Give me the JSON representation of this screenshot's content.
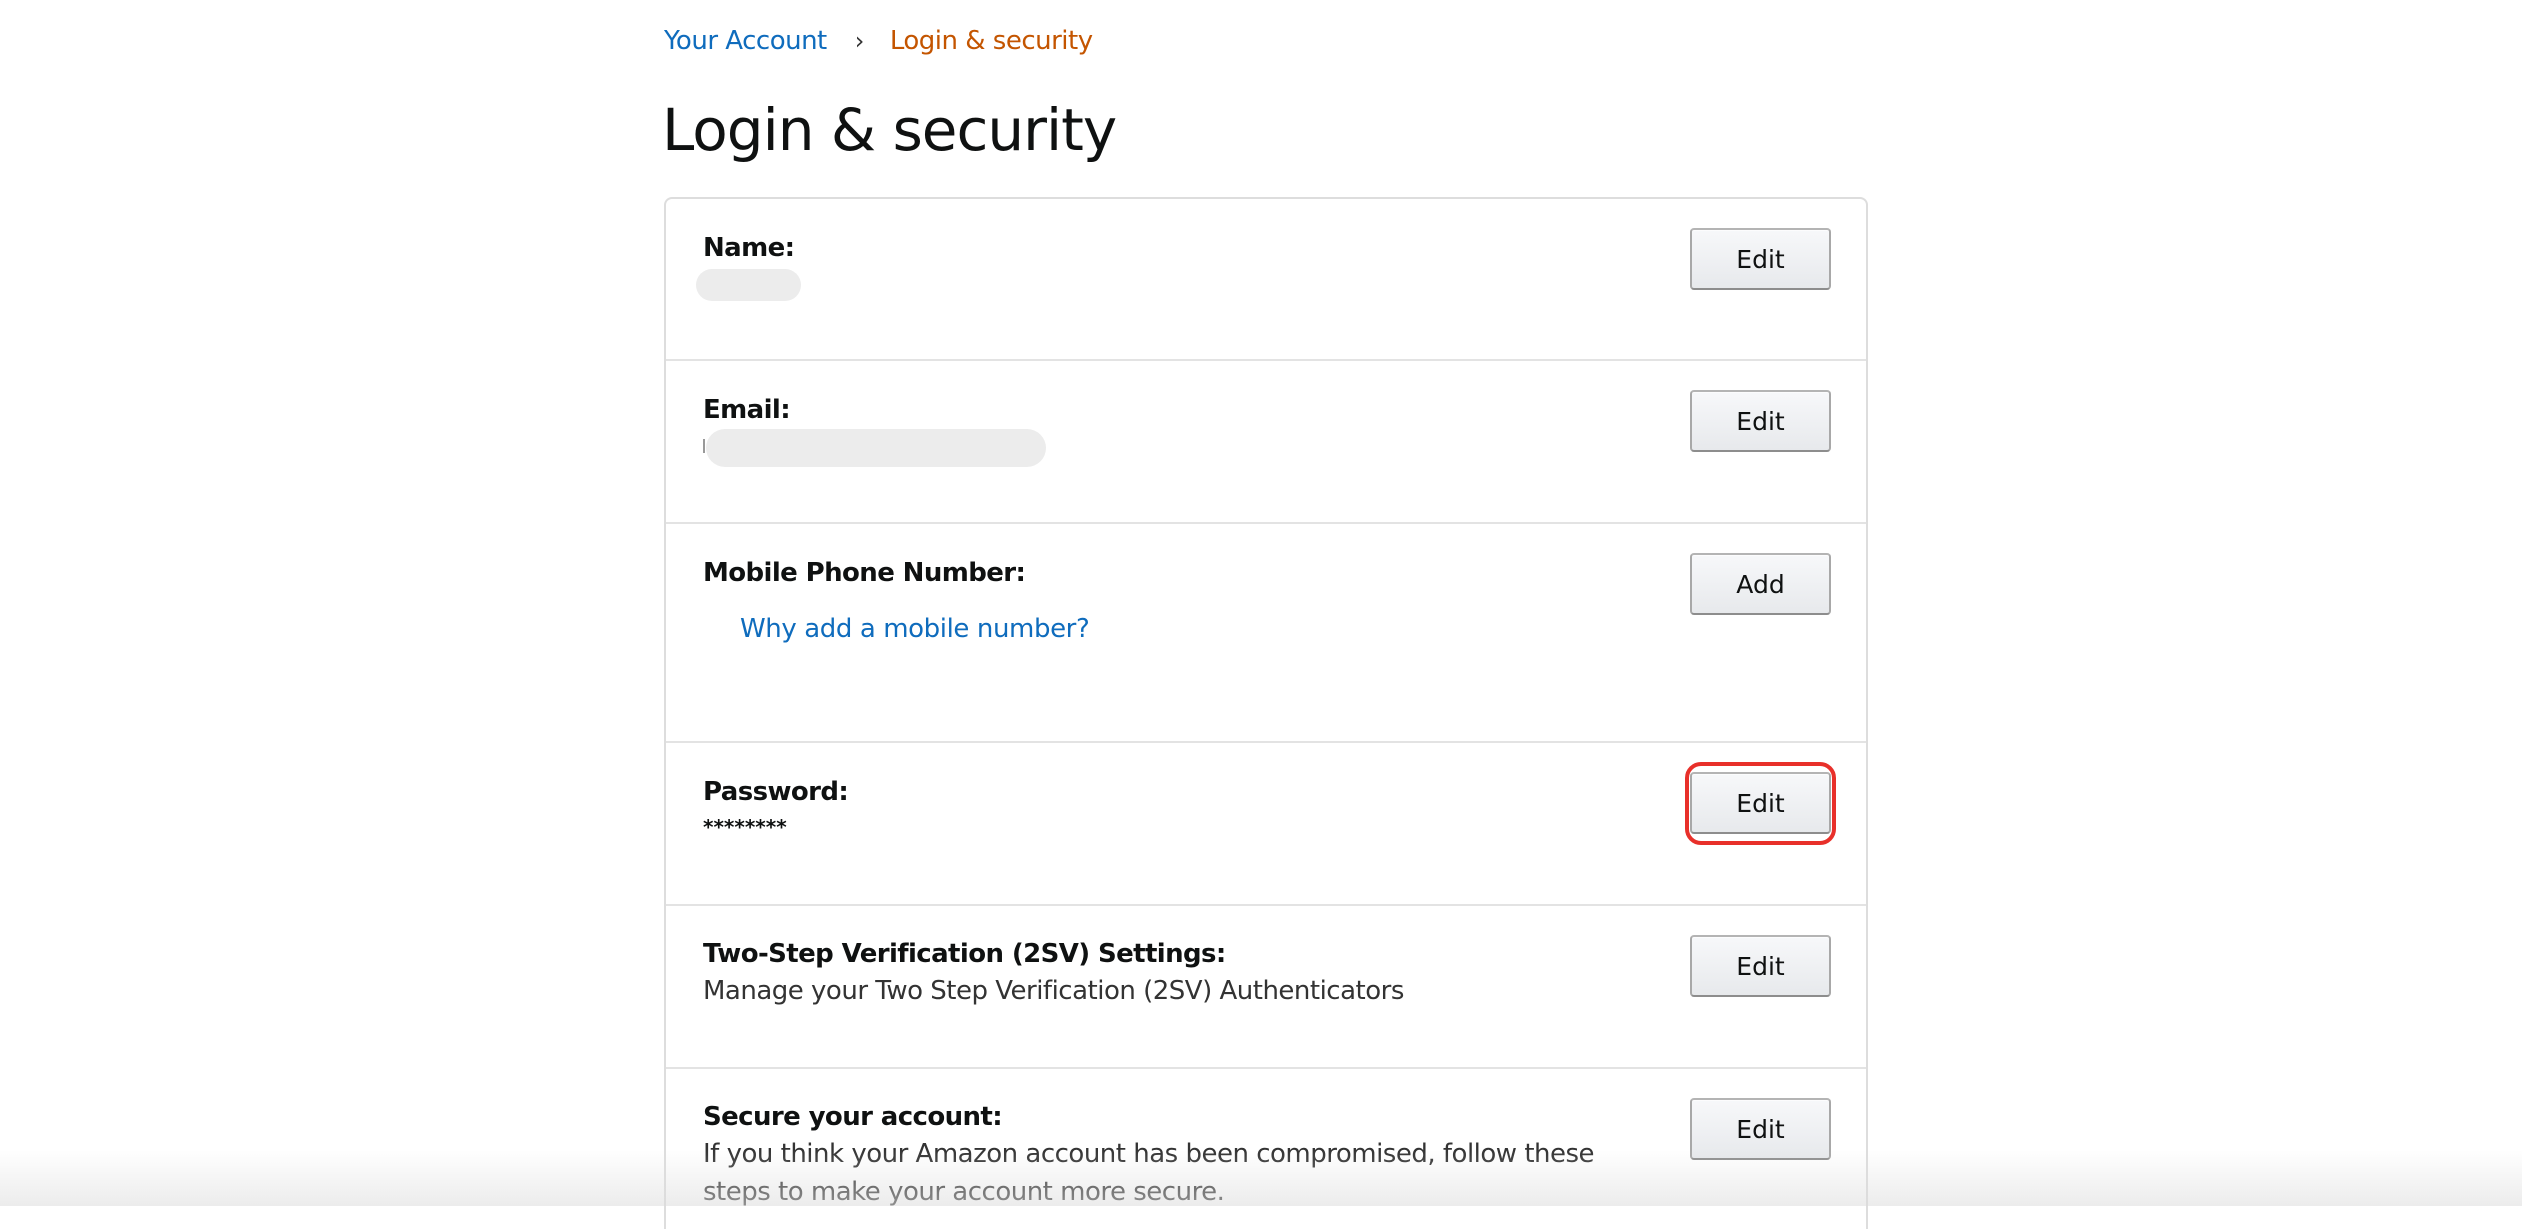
{
  "breadcrumb": {
    "parent": "Your Account",
    "separator": "›",
    "current": "Login & security"
  },
  "page": {
    "title": "Login & security"
  },
  "colors": {
    "link": "#0f6cbd",
    "breadcrumb_current": "#c45500",
    "highlight": "#e8302a"
  },
  "rows": [
    {
      "label": "Name:",
      "value": "",
      "button": "Edit"
    },
    {
      "label": "Email:",
      "value": "",
      "button": "Edit"
    },
    {
      "label": "Mobile Phone Number:",
      "link": "Why add a mobile number?",
      "button": "Add"
    },
    {
      "label": "Password:",
      "value": "********",
      "button": "Edit",
      "highlighted": true
    },
    {
      "label": "Two-Step Verification (2SV) Settings:",
      "description": "Manage your Two Step Verification (2SV) Authenticators",
      "button": "Edit"
    },
    {
      "label": "Secure your account:",
      "description": "If you think your Amazon account has been compromised, follow these steps to make your account more secure.",
      "button": "Edit"
    }
  ]
}
